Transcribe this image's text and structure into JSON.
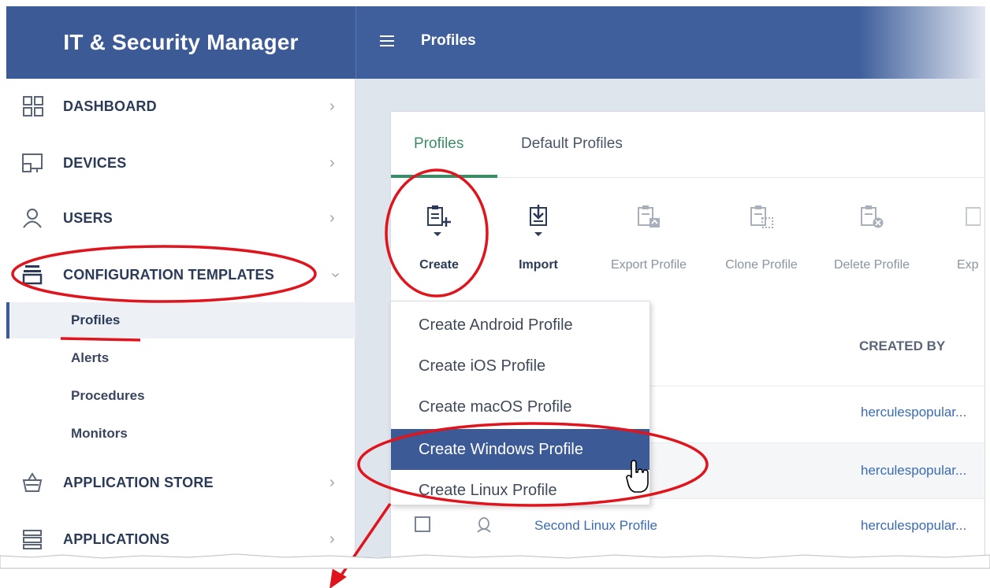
{
  "app": {
    "brand": "IT & Security Manager",
    "page_title": "Profiles"
  },
  "sidebar": {
    "items": [
      {
        "label": "DASHBOARD",
        "icon": "dashboard-grid-icon"
      },
      {
        "label": "DEVICES",
        "icon": "devices-icon"
      },
      {
        "label": "USERS",
        "icon": "user-icon"
      },
      {
        "label": "CONFIGURATION TEMPLATES",
        "icon": "configuration-templates-icon"
      },
      {
        "label": "APPLICATION STORE",
        "icon": "basket-icon"
      },
      {
        "label": "APPLICATIONS",
        "icon": "applications-icon"
      }
    ],
    "subitems": [
      {
        "label": "Profiles",
        "active": true
      },
      {
        "label": "Alerts"
      },
      {
        "label": "Procedures"
      },
      {
        "label": "Monitors"
      }
    ]
  },
  "tabs": [
    {
      "label": "Profiles",
      "active": true
    },
    {
      "label": "Default Profiles"
    }
  ],
  "toolbar": [
    {
      "label": "Create",
      "icon": "create-profile-icon",
      "enabled": true
    },
    {
      "label": "Import",
      "icon": "import-icon",
      "enabled": true
    },
    {
      "label": "Export Profile",
      "icon": "export-profile-icon",
      "enabled": false
    },
    {
      "label": "Clone Profile",
      "icon": "clone-profile-icon",
      "enabled": false
    },
    {
      "label": "Delete Profile",
      "icon": "delete-profile-icon",
      "enabled": false
    },
    {
      "label": "Exp",
      "icon": "export-icon",
      "enabled": false
    }
  ],
  "dropdown": {
    "items": [
      {
        "label": "Create Android Profile"
      },
      {
        "label": "Create iOS Profile"
      },
      {
        "label": "Create macOS Profile"
      },
      {
        "label": "Create Windows Profile",
        "selected": true
      },
      {
        "label": "Create Linux Profile"
      }
    ]
  },
  "table": {
    "columns": [
      "CREATED BY"
    ],
    "rows": [
      {
        "name": "",
        "created_by": "herculespopular..."
      },
      {
        "name": "",
        "created_by": "herculespopular..."
      },
      {
        "name": "Second Linux Profile",
        "created_by": "herculespopular..."
      }
    ]
  },
  "colors": {
    "brand": "#3c5a96",
    "accent_green": "#3a8d66",
    "annotation_red": "#e0141c",
    "link": "#3a6bb5"
  }
}
